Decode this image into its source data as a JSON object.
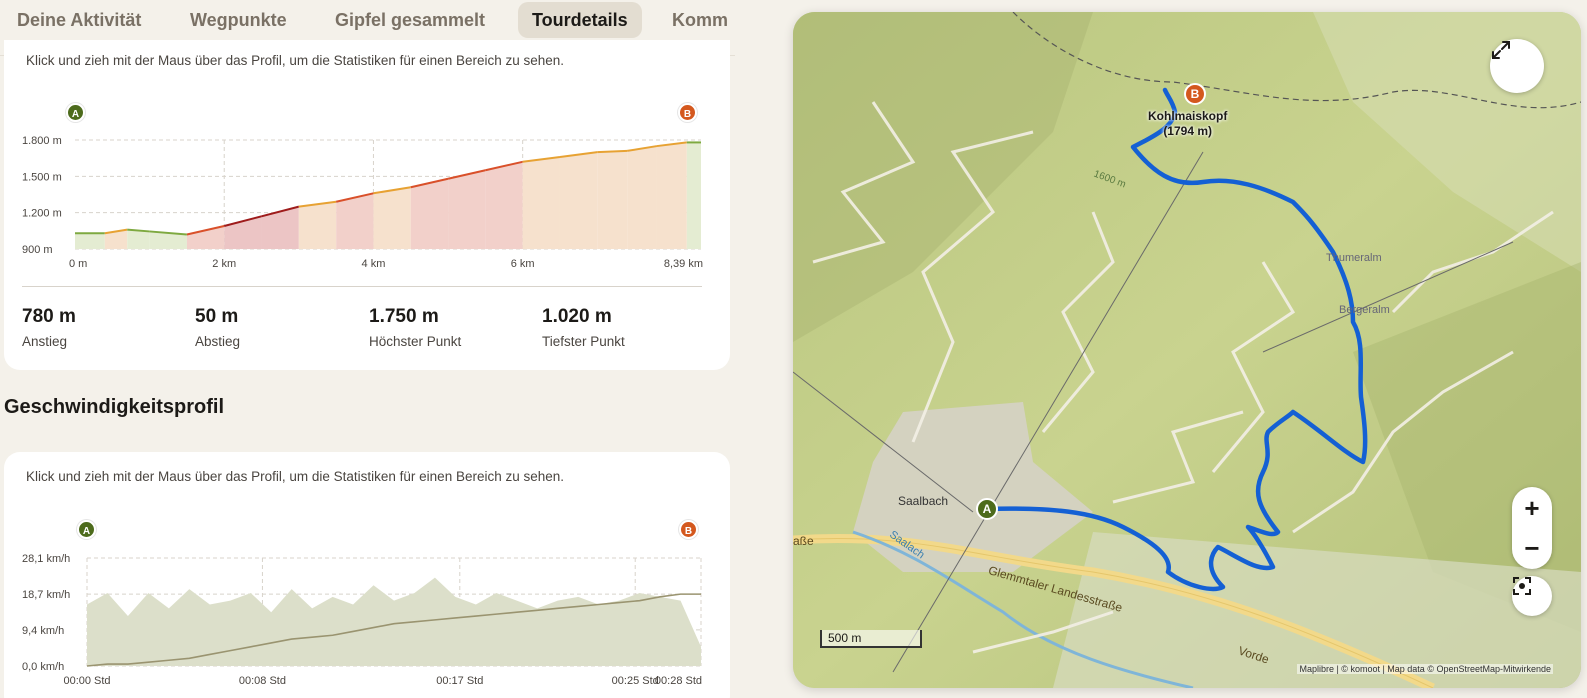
{
  "tabs": [
    {
      "label": "Deine Aktivität"
    },
    {
      "label": "Wegpunkte"
    },
    {
      "label": "Gipfel gesammelt"
    },
    {
      "label": "Tourdetails",
      "active": true
    },
    {
      "label": "Komm"
    }
  ],
  "elevation": {
    "hint": "Klick und zieh mit der Maus über das Profil, um die Statistiken für einen Bereich zu sehen.",
    "start_marker": "A",
    "end_marker": "B",
    "chart_data": {
      "type": "area",
      "x_unit": "km",
      "y_unit": "m",
      "x": [
        0,
        0.4,
        0.7,
        1.0,
        1.5,
        2.0,
        2.5,
        3.0,
        3.5,
        4.0,
        4.5,
        5.0,
        5.5,
        6.0,
        6.5,
        7.0,
        7.4,
        7.8,
        8.2,
        8.39
      ],
      "y": [
        1030,
        1030,
        1060,
        1045,
        1020,
        1090,
        1170,
        1250,
        1290,
        1360,
        1410,
        1480,
        1550,
        1620,
        1660,
        1700,
        1710,
        1750,
        1780,
        1780
      ],
      "ylim": [
        900,
        1800
      ],
      "xlim": [
        0,
        8.39
      ],
      "ytick_labels": [
        "1.800 m",
        "1.500 m",
        "1.200 m",
        "900 m"
      ],
      "ytick_values": [
        1800,
        1500,
        1200,
        900
      ],
      "xtick_labels": [
        "0 m",
        "2 km",
        "4 km",
        "6 km",
        "8,39 km"
      ],
      "xtick_values": [
        0,
        2,
        4,
        6,
        8.39
      ]
    },
    "stats": [
      {
        "value": "780 m",
        "label": "Anstieg"
      },
      {
        "value": "50 m",
        "label": "Abstieg"
      },
      {
        "value": "1.750 m",
        "label": "Höchster Punkt"
      },
      {
        "value": "1.020 m",
        "label": "Tiefster Punkt"
      }
    ]
  },
  "speed": {
    "title": "Geschwindigkeitsprofil",
    "hint": "Klick und zieh mit der Maus über das Profil, um die Statistiken für einen Bereich zu sehen.",
    "start_marker": "A",
    "end_marker": "B",
    "chart_data": {
      "type": "area",
      "x_unit": "min",
      "y_unit": "km/h",
      "series": [
        {
          "values": [
            16,
            19,
            13,
            19,
            15,
            20,
            16,
            17,
            19,
            14,
            20,
            15,
            18,
            16,
            21,
            17,
            19,
            23,
            18,
            16,
            19,
            17,
            15,
            17,
            18,
            16,
            17,
            19,
            18,
            17,
            5
          ]
        },
        {
          "values": [
            0,
            0.5,
            0.5,
            1,
            1.5,
            2,
            3,
            4,
            5,
            6,
            7,
            7.5,
            8,
            9,
            10,
            11,
            11.5,
            12,
            12.5,
            13,
            13.5,
            14,
            14.5,
            15,
            15.5,
            16,
            16.5,
            17,
            18,
            18.7,
            18.7
          ]
        }
      ],
      "ylim": [
        0,
        28.1
      ],
      "ytick_labels": [
        "28,1 km/h",
        "18,7 km/h",
        "9,4 km/h",
        "0,0 km/h"
      ],
      "ytick_values": [
        28.1,
        18.7,
        9.4,
        0
      ],
      "xtick_labels": [
        "00:00 Std",
        "00:08 Std",
        "00:17 Std",
        "00:25 Std",
        "00:28 Std"
      ],
      "xtick_values": [
        0,
        8,
        17,
        25,
        28
      ],
      "xlim": [
        0,
        28
      ]
    }
  },
  "map": {
    "peak_name": "Kohlmaiskopf",
    "peak_height": "(1794 m)",
    "labels": {
      "saalbach": "Saalbach",
      "river": "Saalach",
      "road": "Glemmtaler Landesstraße",
      "thumeralm": "Thumeralm",
      "bergeralm": "Bergeralm",
      "contour": "1600 m",
      "strasse": "aße",
      "vorder": "Vorde"
    },
    "start_marker": "A",
    "end_marker": "B",
    "scale": "500 m",
    "attribution": "Maplibre | © komoot | Map data © OpenStreetMap-Mitwirkende",
    "zoom_in": "+",
    "zoom_out": "−",
    "colors": {
      "route": "#1460d4",
      "terrain": "#c4cf8a",
      "road": "#f2d98a"
    }
  }
}
